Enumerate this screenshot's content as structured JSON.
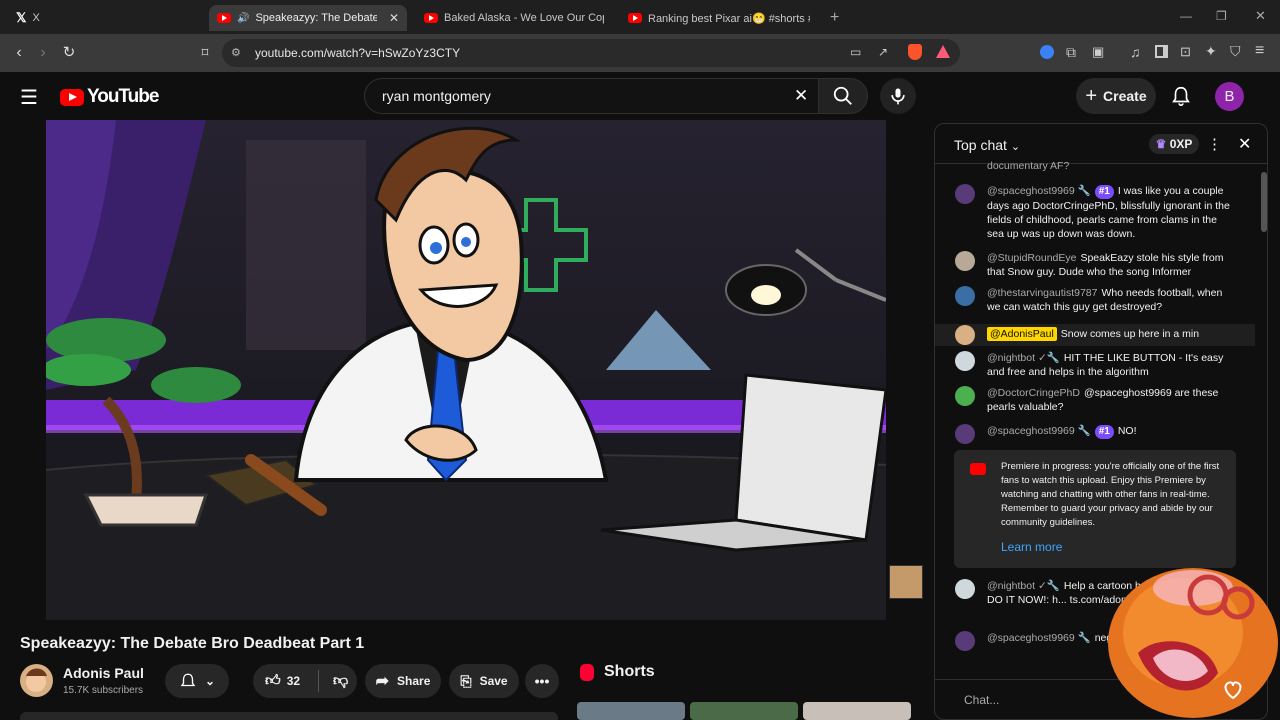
{
  "browser": {
    "tabs": [
      {
        "label": "X"
      },
      {
        "label": "Speakeazyy: The Debate Bro D"
      },
      {
        "label": "Baked Alaska - We Love Our Cops [L"
      },
      {
        "label": "Ranking best Pixar ai😁 #shorts #p"
      }
    ],
    "url": "youtube.com/watch?v=hSwZoYz3CTY"
  },
  "header": {
    "logo": "YouTube",
    "search_value": "ryan montgomery",
    "create_label": "Create",
    "avatar_letter": "B"
  },
  "video": {
    "title": "Speakeazyy: The Debate Bro Deadbeat Part 1",
    "channel": "Adonis Paul",
    "subscribers": "15.7K subscribers",
    "likes": "32",
    "share_label": "Share",
    "save_label": "Save"
  },
  "shorts": {
    "label": "Shorts"
  },
  "chat": {
    "title": "Top chat",
    "xp": "0XP",
    "partial_top": "documentary AF?",
    "messages": [
      {
        "author": "@spaceghost9969 🔧",
        "badge": "#1",
        "text": "I was like you a couple days ago DoctorCringePhD, blissfully ignorant in the fields of childhood, pearls came from clams in the sea up was up down was down.",
        "avatar_color": "#5a3b7a"
      },
      {
        "author": "@StupidRoundEye",
        "badge": "",
        "text": "SpeakEazy stole his style from that Snow guy. Dude who the song Informer",
        "avatar_color": "#b8a898"
      },
      {
        "author": "@thestarvingautist9787",
        "badge": "",
        "text": "Who needs football, when we can watch this guy get destroyed?",
        "avatar_color": "#3b6ea5"
      },
      {
        "author": "@AdonisPaul",
        "badge": "",
        "text": "Snow comes up here in a min",
        "avatar_color": "#d8b083",
        "owner": true
      },
      {
        "author": "@nightbot ✓🔧",
        "badge": "",
        "text": "HIT THE LIKE BUTTON - It's easy and free and helps in the algorithm",
        "avatar_color": "#cfd8dc"
      },
      {
        "author": "@DoctorCringePhD",
        "badge": "",
        "text": "@spaceghost9969 are these pearls valuable?",
        "avatar_color": "#4caf50"
      },
      {
        "author": "@spaceghost9969 🔧",
        "badge": "#1",
        "text": "NO!",
        "avatar_color": "#5a3b7a"
      }
    ],
    "premiere_text": "Premiere in progress: you're officially one of the first fans to watch this upload. Enjoy this Premiere by watching and chatting with other fans in real-time. Remember to guard your privacy and abide by our community guidelines.",
    "learn_more": "Learn more",
    "after_messages": [
      {
        "author": "@nightbot ✓🔧",
        "badge": "",
        "text": "Help a cartoon h... Night on the Air. DO IT NOW!: h... ts.com/adonispaul...",
        "avatar_color": "#cfd8dc"
      },
      {
        "author": "@spaceghost9969 🔧",
        "badge": "",
        "text": "negative worth!",
        "avatar_color": "#5a3b7a"
      }
    ],
    "input_placeholder": "Chat..."
  }
}
